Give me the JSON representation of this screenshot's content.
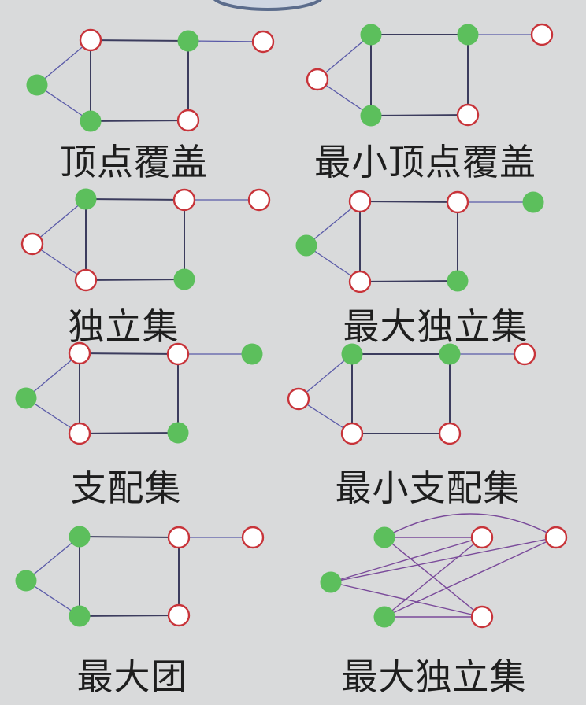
{
  "colors": {
    "background": "#d9dadb",
    "selected_fill": "#5cbf5c",
    "unselected_stroke": "#c8343a",
    "unselected_fill": "#ffffff",
    "edge": "#4a4a7a"
  },
  "panels": [
    {
      "label": "顶点覆盖",
      "selected": [
        "L",
        "TR",
        "BL"
      ]
    },
    {
      "label": "最小顶点覆盖",
      "selected": [
        "TL",
        "TR",
        "BL"
      ]
    },
    {
      "label": "独立集",
      "selected": [
        "TL",
        "BR"
      ]
    },
    {
      "label": "最大独立集",
      "selected": [
        "L",
        "BR",
        "P"
      ]
    },
    {
      "label": "支配集",
      "selected": [
        "L",
        "BR",
        "P"
      ]
    },
    {
      "label": "最小支配集",
      "selected": [
        "TL",
        "TR"
      ]
    },
    {
      "label": "最大团",
      "selected": [
        "L",
        "TL",
        "BL"
      ]
    },
    {
      "label": "最大独立集",
      "selected": [
        "A",
        "B",
        "C"
      ]
    }
  ]
}
